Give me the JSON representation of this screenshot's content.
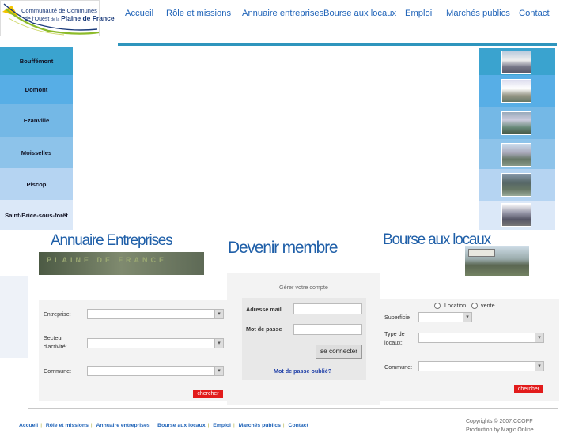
{
  "logo": {
    "line1": "Communauté de Communes",
    "line2_pre": "de l'Ouest",
    "line2_mid": "de la",
    "line2_end": "Plaine de France"
  },
  "nav": [
    "Accueil",
    "Rôle et missions",
    "Annuaire entreprises",
    "Bourse aux locaux",
    "Emploi",
    "Marchés publics",
    "Contact"
  ],
  "communes": [
    "Bouffémont",
    "Domont",
    "Ezanville",
    "Moisselles",
    "Piscop",
    "Saint-Brice-sous-forêt"
  ],
  "commune_colors": [
    "#3aa3cf",
    "#57aee6",
    "#74b8e6",
    "#8dc3ea",
    "#b5d4f2",
    "#dbe8f8"
  ],
  "annuaire": {
    "title": "Annuaire Entreprises",
    "banner": "PLAINE  DE  FRANCE",
    "label_entreprise": "Entreprise:",
    "label_secteur1": "Secteur",
    "label_secteur2": "d'activité:",
    "label_commune": "Commune:",
    "search_button": "chercher"
  },
  "membre": {
    "title": "Devenir membre",
    "caption": "Gérer votre compte",
    "label_email": "Adresse mail",
    "label_password": "Mot de passe",
    "login_button": "se connecter",
    "forgot_link": "Mot de passe oublié?"
  },
  "locaux": {
    "title": "Bourse aux locaux",
    "radio_location": "Location",
    "radio_vente": "vente",
    "label_superficie": "Superficie",
    "label_type1": "Type de",
    "label_type2": "locaux:",
    "label_commune": "Commune:",
    "search_button": "chercher"
  },
  "footer": {
    "links": [
      "Accueil",
      "Rôle et missions",
      "Annuaire entreprises",
      "Bourse aux locaux",
      "Emploi",
      "Marchés publics",
      "Contact"
    ],
    "copyright": "Copyrights © 2007.CCOPF",
    "credit": "Production by Magic Online"
  }
}
